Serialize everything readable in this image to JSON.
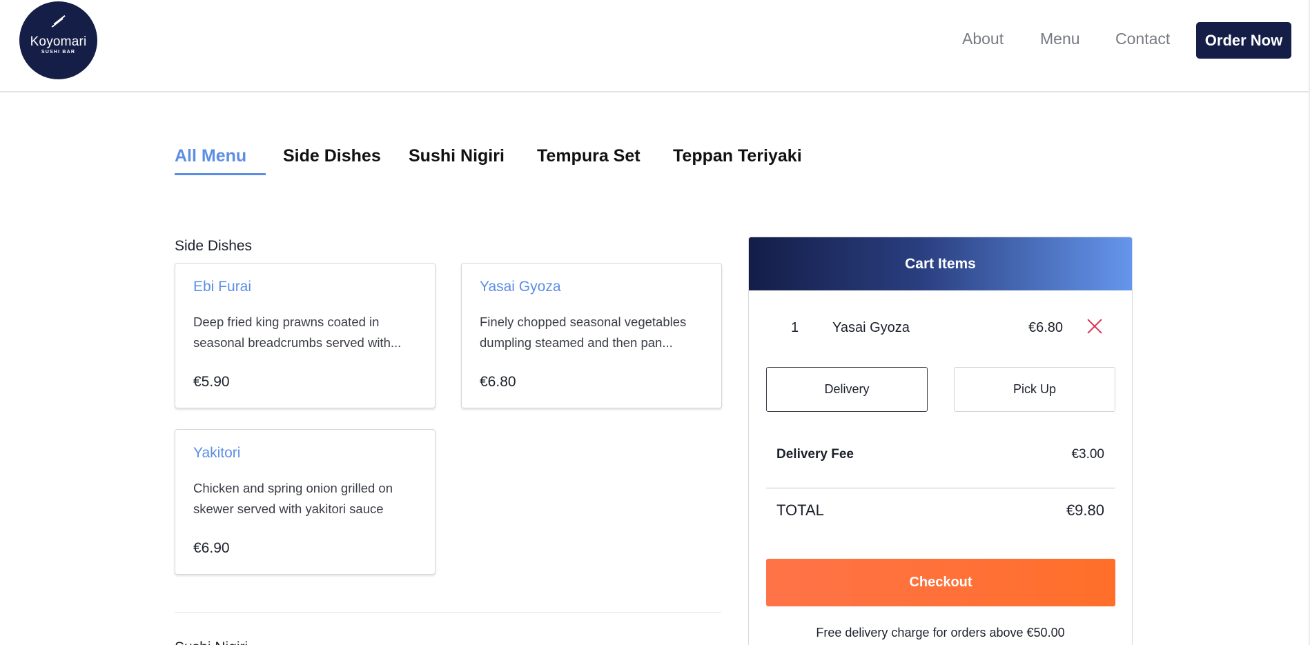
{
  "brand": {
    "name": "Koyomari",
    "tagline": "SUSHI BAR"
  },
  "nav": {
    "about": "About",
    "menu": "Menu",
    "contact": "Contact",
    "order_now": "Order Now"
  },
  "tabs": [
    {
      "label": "All Menu",
      "active": true
    },
    {
      "label": "Side Dishes"
    },
    {
      "label": "Sushi Nigiri"
    },
    {
      "label": "Tempura Set"
    },
    {
      "label": "Teppan Teriyaki"
    }
  ],
  "sections": [
    {
      "title": "Side Dishes",
      "items": [
        {
          "name": "Ebi Furai",
          "description": "Deep fried king prawns coated in seasonal breadcrumbs served with...",
          "price": "€5.90"
        },
        {
          "name": "Yasai Gyoza",
          "description": "Finely chopped seasonal vegetables dumpling steamed and then pan...",
          "price": "€6.80"
        },
        {
          "name": "Yakitori",
          "description": "Chicken and spring onion grilled on skewer served with yakitori sauce",
          "price": "€6.90"
        }
      ]
    },
    {
      "title": "Sushi Nigiri"
    }
  ],
  "cart": {
    "title": "Cart Items",
    "items": [
      {
        "qty": "1",
        "name": "Yasai Gyoza",
        "price": "€6.80"
      }
    ],
    "options": {
      "delivery": "Delivery",
      "pickup": "Pick Up",
      "selected": "Delivery"
    },
    "delivery_fee_label": "Delivery Fee",
    "delivery_fee": "€3.00",
    "total_label": "TOTAL",
    "total": "€9.80",
    "checkout": "Checkout",
    "note": "Free delivery charge for orders above €50.00"
  },
  "colors": {
    "brand_navy": "#151e47",
    "accent_blue": "#5c8ee6",
    "checkout_orange": "#ff6f2a",
    "remove_red": "#d9304f"
  }
}
